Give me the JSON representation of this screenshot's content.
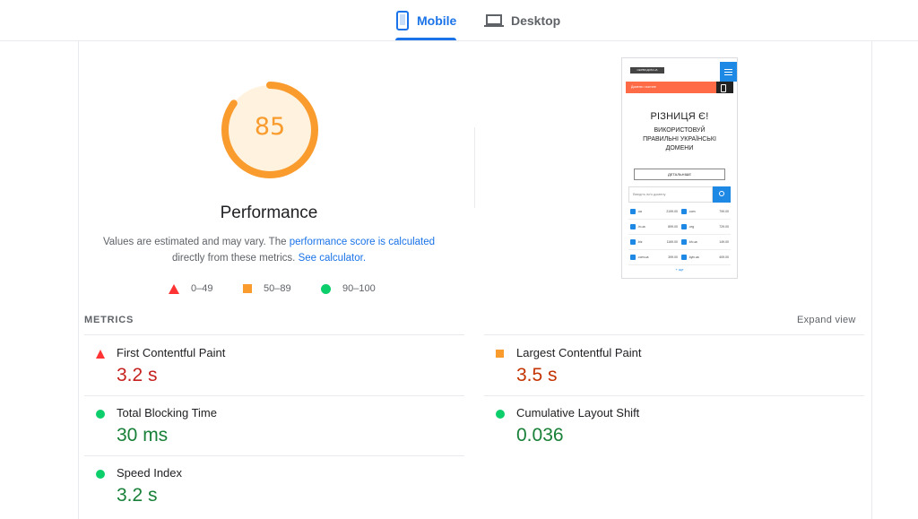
{
  "tabs": [
    {
      "label": "Mobile",
      "active": true,
      "icon": "smartphone-icon"
    },
    {
      "label": "Desktop",
      "active": false,
      "icon": "laptop-icon"
    }
  ],
  "performance": {
    "score": "85",
    "score_fraction": 0.85,
    "title": "Performance",
    "desc_prefix": "Values are estimated and may vary. The ",
    "desc_link1": "performance score is calculated",
    "desc_middle": " directly from these metrics. ",
    "desc_link2": "See calculator.",
    "gauge_color": "#fa9b2d",
    "gauge_bg": "#fff3e0"
  },
  "legend": [
    {
      "range": "0–49",
      "shape": "triangle",
      "color": "#ff3333"
    },
    {
      "range": "50–89",
      "shape": "square",
      "color": "#fa9b2d"
    },
    {
      "range": "90–100",
      "shape": "circle",
      "color": "#0cce6b"
    }
  ],
  "screenshot": {
    "logo_text": "СЕРВІСДОМ.UA",
    "banner_text": "Домени • хостинг",
    "heading": "РІЗНИЦЯ Є!",
    "subheading": "ВИКОРИСТОВУЙ ПРАВИЛЬНІ УКРАЇНСЬКІ ДОМЕНИ",
    "button_text": "ДЕТАЛЬНІШЕ",
    "search_placeholder": "Введіть ім'я домену",
    "domains": [
      [
        {
          "name": ".ua",
          "price": "2199.00"
        },
        {
          "name": ".com",
          "price": "799.00"
        }
      ],
      [
        {
          "name": ".in.ua",
          "price": "899.00"
        },
        {
          "name": ".org",
          "price": "729.00"
        }
      ],
      [
        {
          "name": ".biz",
          "price": "1169.00"
        },
        {
          "name": ".kh.ua",
          "price": "149.00"
        }
      ],
      [
        {
          "name": ".com.ua",
          "price": "399.00"
        },
        {
          "name": ".kyiv.ua",
          "price": "409.00"
        }
      ]
    ],
    "more_text": "+ ще"
  },
  "metrics": {
    "heading": "METRICS",
    "expand_label": "Expand view",
    "items": [
      {
        "label": "First Contentful Paint",
        "value": "3.2 s",
        "status": "fail"
      },
      {
        "label": "Largest Contentful Paint",
        "value": "3.5 s",
        "status": "average"
      },
      {
        "label": "Total Blocking Time",
        "value": "30 ms",
        "status": "pass"
      },
      {
        "label": "Cumulative Layout Shift",
        "value": "0.036",
        "status": "pass"
      },
      {
        "label": "Speed Index",
        "value": "3.2 s",
        "status": "pass"
      }
    ]
  }
}
